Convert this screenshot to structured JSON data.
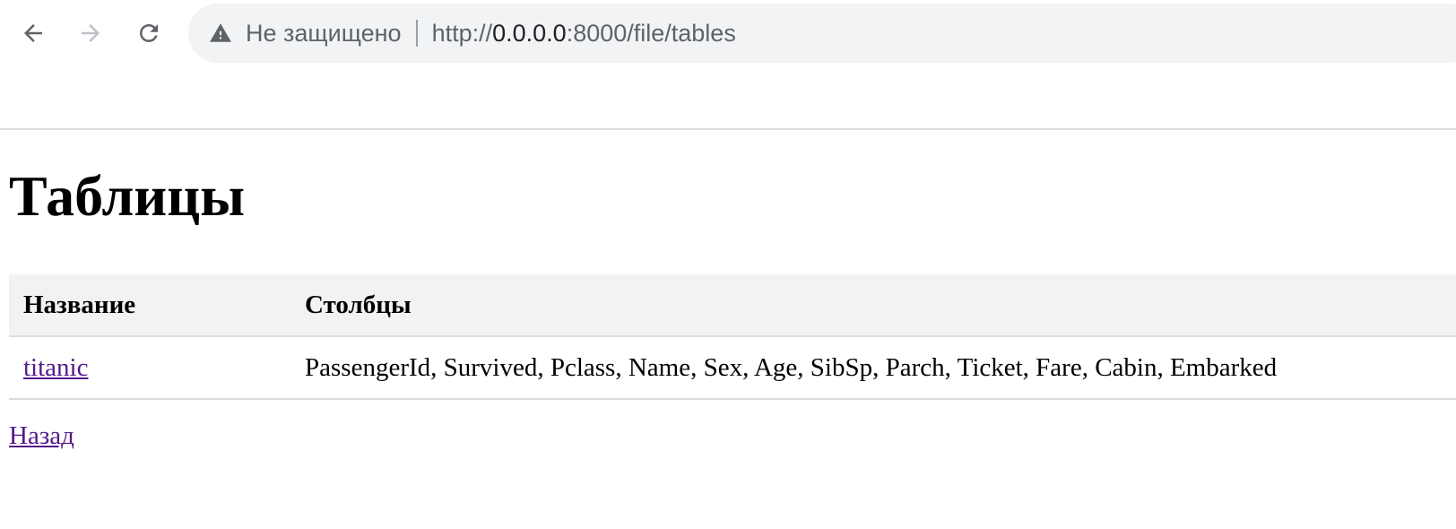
{
  "browser": {
    "security_label": "Не защищено",
    "url_scheme": "http://",
    "url_host": "0.0.0.0",
    "url_rest": ":8000/file/tables",
    "icons": {
      "back": "arrow-left-icon",
      "forward": "arrow-right-icon",
      "reload": "reload-icon",
      "warning": "warning-triangle-icon"
    }
  },
  "page": {
    "title": "Таблицы",
    "table": {
      "headers": [
        "Название",
        "Столбцы"
      ],
      "rows": [
        {
          "name": "titanic",
          "columns": "PassengerId, Survived, Pclass, Name, Sex, Age, SibSp, Parch, Ticket, Fare, Cabin, Embarked"
        }
      ]
    },
    "back_link": "Назад"
  },
  "colors": {
    "visited_link": "#551a8b",
    "header_bg": "#f2f2f2",
    "omnibox_bg": "#f1f3f4"
  }
}
